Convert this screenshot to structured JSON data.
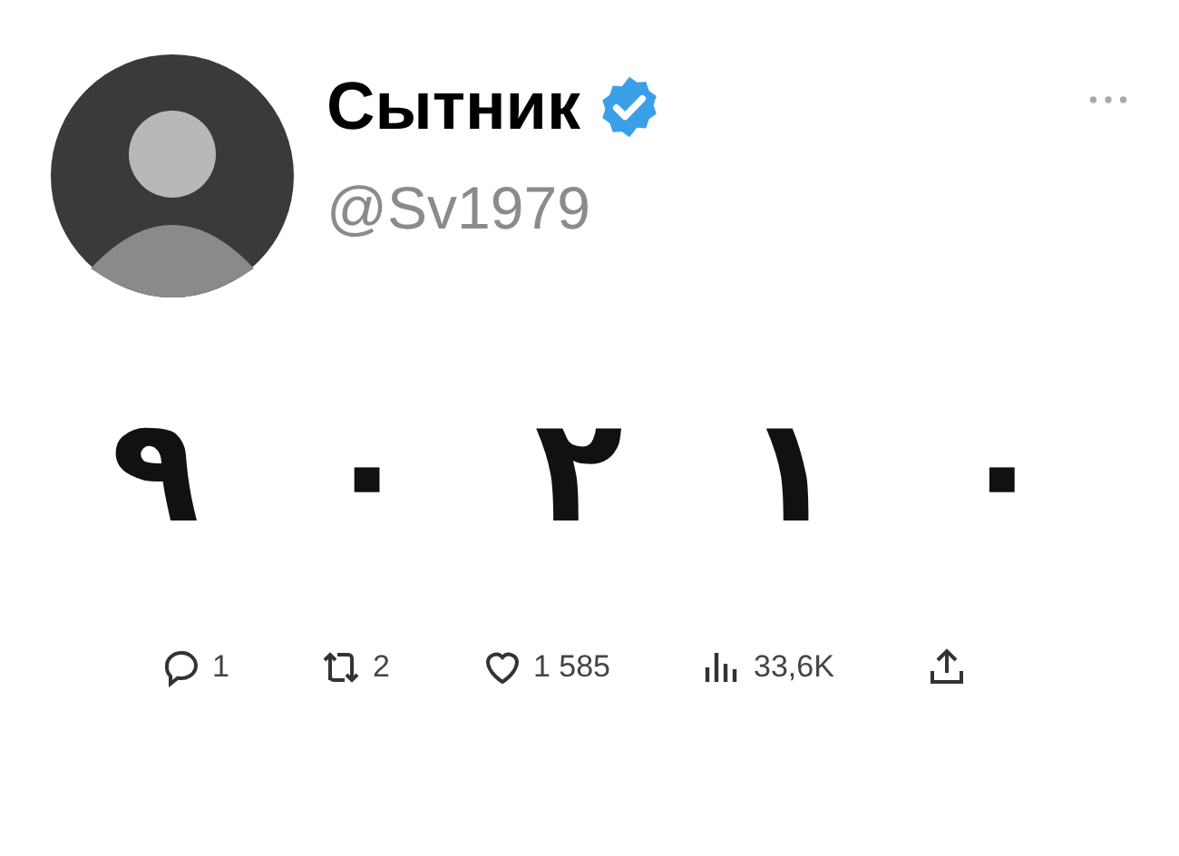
{
  "author": {
    "name": "Сытник",
    "verified": true,
    "handle": "@Sv1979"
  },
  "tweet": {
    "text": "٩ ٠ ٢ ١ ٠"
  },
  "actions": [
    {
      "kind": "reply",
      "count": "1"
    },
    {
      "kind": "retweet",
      "count": "2"
    },
    {
      "kind": "like",
      "count": "1 585"
    },
    {
      "kind": "views",
      "count": "33,6K"
    },
    {
      "kind": "share"
    }
  ]
}
